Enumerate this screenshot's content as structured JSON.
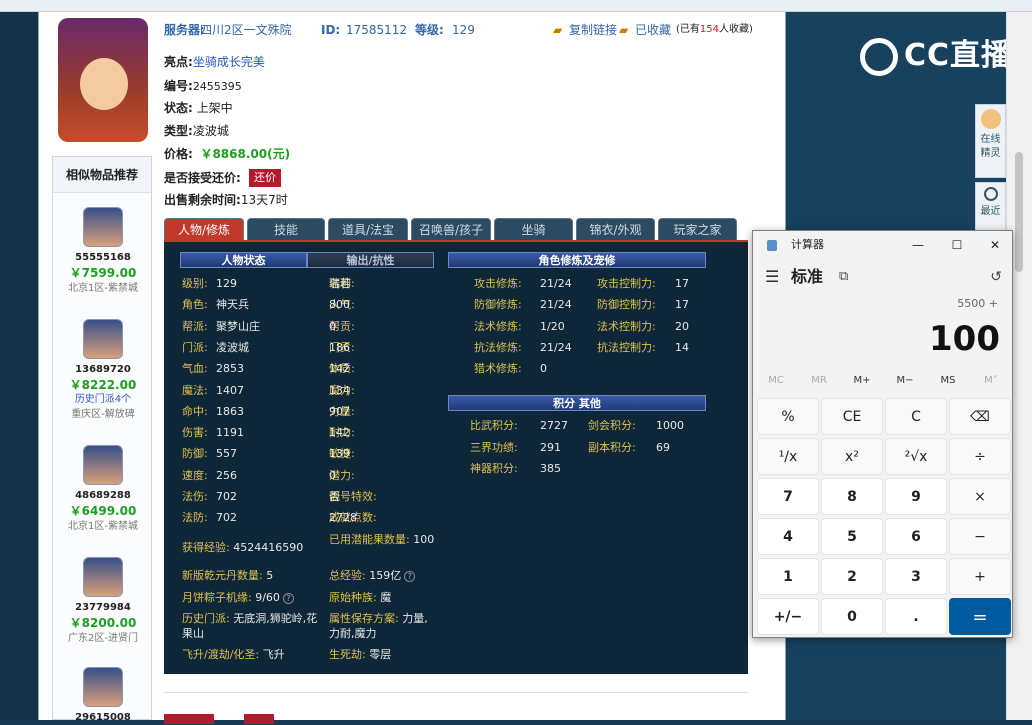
{
  "browser": {
    "tabs": [
      "",
      "",
      "",
      "",
      ""
    ]
  },
  "live": {
    "brand": "CC直播",
    "side_buttons": [
      {
        "label": "在线精灵"
      },
      {
        "label": "最近"
      }
    ]
  },
  "listing": {
    "server_label": "服务器:",
    "server": "四川2区一文殊院",
    "id_label": "ID:",
    "id": "17585112",
    "level_label": "等级:",
    "level": "129",
    "copy_link": "复制链接",
    "favorited": "已收藏",
    "fav_prefix": "(已有",
    "fav_count": "154",
    "fav_suffix": "人收藏)",
    "highlight_label": "亮点:",
    "highlight": "坐骑成长完美",
    "number_label": "编号:",
    "number": "2455395",
    "status_label": "状态:",
    "status": "上架中",
    "type_label": "类型:",
    "type": "凌波城",
    "price_label": "价格:",
    "price": "￥8868.00(元)",
    "counter_label": "是否接受还价:",
    "counter_btn": "还价",
    "remain_label": "出售剩余时间:",
    "remain": "13天7时"
  },
  "similar": {
    "title": "相似物品推荐",
    "items": [
      {
        "id": "55555168",
        "price": "￥7599.00",
        "sub": "",
        "server": "北京1区-紫禁城"
      },
      {
        "id": "13689720",
        "price": "￥8222.00",
        "sub": "历史门派4个",
        "server": "重庆区-解放碑"
      },
      {
        "id": "48689288",
        "price": "￥6499.00",
        "sub": "",
        "server": "北京1区-紫禁城"
      },
      {
        "id": "23779984",
        "price": "￥8200.00",
        "sub": "",
        "server": "广东2区-进贤门"
      },
      {
        "id": "29615008",
        "price": "",
        "sub": "",
        "server": ""
      }
    ]
  },
  "tabs": [
    "人物/修炼",
    "技能",
    "道具/法宝",
    "召唤兽/孩子",
    "坐骑",
    "锦衣/外观",
    "玩家之家"
  ],
  "panel": {
    "left_headers": [
      "人物状态",
      "输出/抗性"
    ],
    "right_headers": [
      "角色修炼及宠修",
      "积分 其他"
    ],
    "col1": [
      {
        "k": "级别:",
        "v": "129"
      },
      {
        "k": "角色:",
        "v": "神天兵"
      },
      {
        "k": "帮派:",
        "v": "聚梦山庄"
      },
      {
        "k": "门派:",
        "v": "凌波城"
      },
      {
        "k": "气血:",
        "v": "2853"
      },
      {
        "k": "魔法:",
        "v": "1407"
      },
      {
        "k": "命中:",
        "v": "1863"
      },
      {
        "k": "伤害:",
        "v": "1191"
      },
      {
        "k": "防御:",
        "v": "557"
      },
      {
        "k": "速度:",
        "v": "256"
      },
      {
        "k": "法伤:",
        "v": "702"
      },
      {
        "k": "法防:",
        "v": "702"
      }
    ],
    "col2": [
      {
        "k": "名称:",
        "v": "瑞若"
      },
      {
        "k": "人气:",
        "v": "800"
      },
      {
        "k": "帮贡:",
        "v": "0"
      },
      {
        "k": "门贡:",
        "v": "186"
      },
      {
        "k": "体质:",
        "v": "142"
      },
      {
        "k": "魔力:",
        "v": "134"
      },
      {
        "k": "力量:",
        "v": "907"
      },
      {
        "k": "耐力:",
        "v": "142"
      },
      {
        "k": "敏捷:",
        "v": "139"
      },
      {
        "k": "潜力:",
        "v": "0"
      },
      {
        "k": "靓号特效:",
        "v": "否"
      },
      {
        "k": "成就点数:",
        "v": "2728"
      }
    ],
    "extra": {
      "exp_k": "获得经验:",
      "exp_v": "4524416590",
      "potential_k": "已用潜能果数量:",
      "potential_v": "100",
      "qiankun_k": "新版乾元丹数量:",
      "qiankun_v": "5",
      "total_exp_k": "总经验:",
      "total_exp_v": "159亿",
      "mooncake_k": "月饼粽子机缘:",
      "mooncake_v": "9/60",
      "race_k": "原始种族:",
      "race_v": "魔",
      "hist_k": "历史门派:",
      "hist_v": "无底洞,狮驼岭,花果山",
      "attr_k": "属性保存方案:",
      "attr_v": "力量,力耐,魔力",
      "ascend_k": "飞升/渡劫/化圣:",
      "ascend_v": "飞升",
      "life_k": "生死劫:",
      "life_v": "零层"
    },
    "cult_left": [
      {
        "k": "攻击修炼:",
        "v": "21/24"
      },
      {
        "k": "防御修炼:",
        "v": "21/24"
      },
      {
        "k": "法术修炼:",
        "v": "1/20"
      },
      {
        "k": "抗法修炼:",
        "v": "21/24"
      },
      {
        "k": "猎术修炼:",
        "v": "0"
      }
    ],
    "cult_right": [
      {
        "k": "攻击控制力:",
        "v": "17"
      },
      {
        "k": "防御控制力:",
        "v": "17"
      },
      {
        "k": "法术控制力:",
        "v": "20"
      },
      {
        "k": "抗法控制力:",
        "v": "14"
      }
    ],
    "score_left": [
      {
        "k": "比武积分:",
        "v": "2727"
      },
      {
        "k": "三界功绩:",
        "v": "291"
      },
      {
        "k": "神器积分:",
        "v": "385"
      }
    ],
    "score_right": [
      {
        "k": "剑会积分:",
        "v": "1000"
      },
      {
        "k": "副本积分:",
        "v": "69"
      }
    ]
  },
  "calculator": {
    "title": "计算器",
    "mode": "标准",
    "expression": "5500 +",
    "display": "100",
    "memory": [
      "MC",
      "MR",
      "M+",
      "M−",
      "MS",
      "M˅"
    ],
    "keys": [
      "%",
      "CE",
      "C",
      "⌫",
      "¹/x",
      "x²",
      "²√x",
      "÷",
      "7",
      "8",
      "9",
      "×",
      "4",
      "5",
      "6",
      "−",
      "1",
      "2",
      "3",
      "+",
      "+/−",
      "0",
      ".",
      "="
    ]
  }
}
